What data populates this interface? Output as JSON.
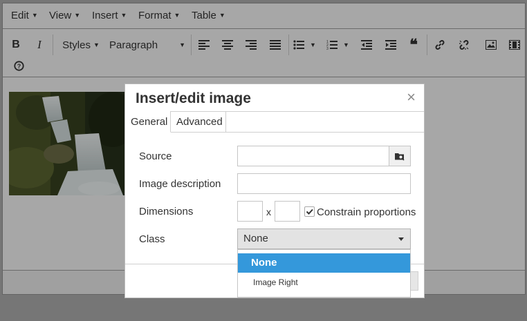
{
  "menubar": {
    "items": [
      {
        "label": "Edit"
      },
      {
        "label": "View"
      },
      {
        "label": "Insert"
      },
      {
        "label": "Format"
      },
      {
        "label": "Table"
      }
    ]
  },
  "toolbar": {
    "bold": "B",
    "italic": "I",
    "styles_label": "Styles",
    "paragraph_label": "Paragraph",
    "blockquote": "❝"
  },
  "dialog": {
    "title": "Insert/edit image",
    "close": "×",
    "tabs": [
      {
        "label": "General",
        "active": true
      },
      {
        "label": "Advanced",
        "active": false
      }
    ],
    "fields": {
      "source_label": "Source",
      "source_value": "",
      "description_label": "Image description",
      "description_value": "",
      "dimensions_label": "Dimensions",
      "width_value": "",
      "height_value": "",
      "dimension_separator": "x",
      "constrain_label": "Constrain proportions",
      "constrain_checked": true,
      "class_label": "Class",
      "class_value": "None"
    }
  },
  "dropdown": {
    "options": [
      {
        "label": "None",
        "selected": true
      },
      {
        "label": "Image Right",
        "selected": false
      }
    ]
  },
  "colors": {
    "accent": "#3498db",
    "overlay": "rgba(0,0,0,0.3)"
  }
}
